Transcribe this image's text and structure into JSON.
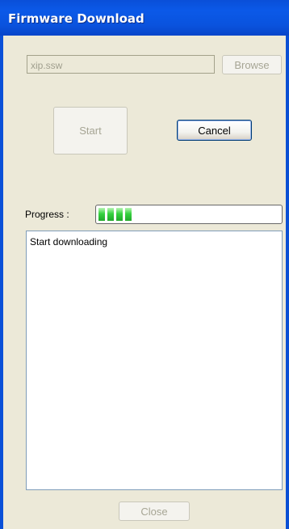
{
  "window": {
    "title": "Firmware Download"
  },
  "file": {
    "value": "xip.ssw"
  },
  "buttons": {
    "browse": "Browse",
    "start": "Start",
    "cancel": "Cancel",
    "close": "Close"
  },
  "progress": {
    "label": "Progress :",
    "value_fraction": 0.2
  },
  "log": {
    "text": "Start downloading"
  },
  "colors": {
    "titlebar": "#0a53de",
    "client_bg": "#ece9d8",
    "progress_block": "#36d23f"
  }
}
